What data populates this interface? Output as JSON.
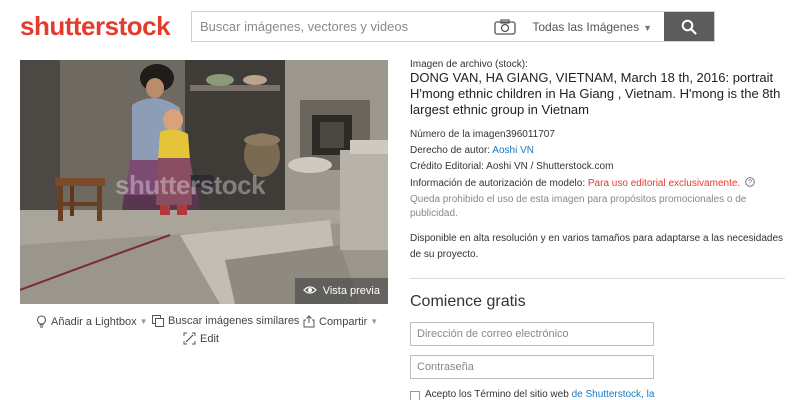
{
  "header": {
    "logo": "shutterstock",
    "search_placeholder": "Buscar imágenes, vectores y videos",
    "filter_label": "Todas las Imágenes"
  },
  "photo": {
    "watermark": "shutterstock",
    "preview_label": "Vista previa"
  },
  "actions": {
    "lightbox": "Añadir a Lightbox",
    "similar": "Buscar imágenes similares",
    "share": "Compartir",
    "edit": "Edit"
  },
  "details": {
    "type_label": "Imagen de archivo (stock):",
    "title": "DONG VAN, HA GIANG, VIETNAM, March 18 th, 2016: portrait H'mong ethnic children in Ha Giang , Vietnam. H'mong is the 8th largest ethnic group in Vietnam",
    "image_number_label": "Número de la imagen",
    "image_number": "396011707",
    "author_label": "Derecho de autor:",
    "author": "Aoshi VN",
    "credit_label": "Crédito Editorial:",
    "credit": "Aoshi VN / Shutterstock.com",
    "model_label": "Información de autorización de modelo:",
    "model_value": "Para uso editorial exclusivamente.",
    "prohibited": "Queda prohibido el uso de esta imagen para propósitos promocionales o de publicidad.",
    "availability": "Disponible en alta resolución y en varios tamaños para adaptarse a las necesidades de su proyecto."
  },
  "signup": {
    "heading": "Comience gratis",
    "email_placeholder": "Dirección de correo electrónico",
    "password_placeholder": "Contraseña",
    "terms_prefix": "Acepto los Término del sitio web",
    "terms_link": "de Shutterstock",
    "terms_suffix": ", la"
  },
  "colors": {
    "brand_red": "#e33b2c",
    "link_blue": "#1a78c2",
    "search_button": "#5c5c5c"
  }
}
